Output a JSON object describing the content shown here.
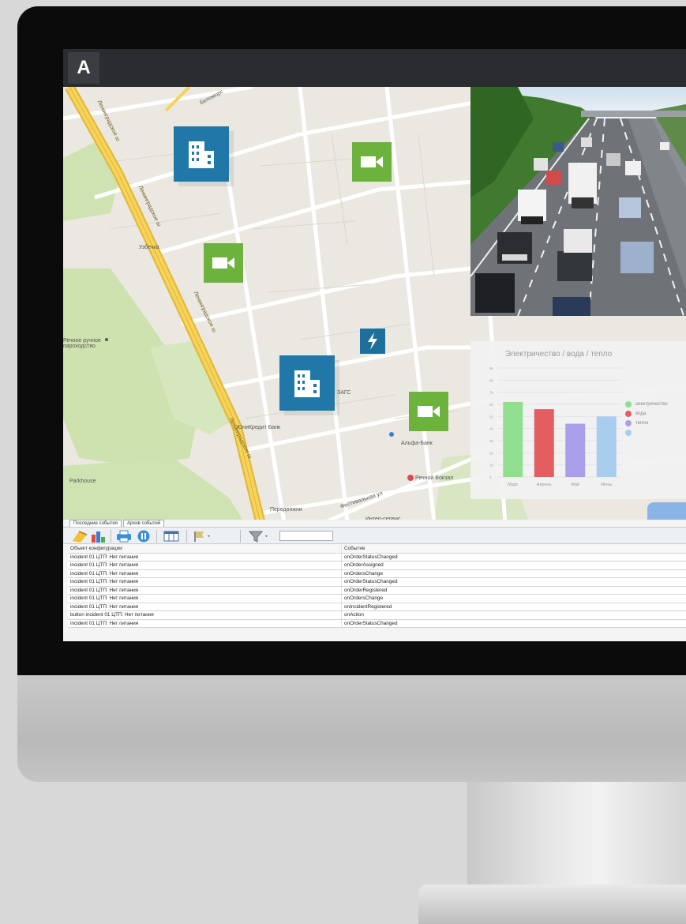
{
  "app": {
    "logo_letter": "A"
  },
  "map": {
    "labels": {
      "road1": "Ленинградское ш",
      "road2": "Ленинградское ш",
      "road3": "Ленинградское ш",
      "road4": "Ленинградское ш",
      "street_top": "Беломорс",
      "uzbekistan": "Узбечка",
      "rechnoe": "Речное ручное пароходство",
      "zags": "ЗАГС",
      "unicredit": "ЮниКредит Банк",
      "alfa": "Альфа-Банк",
      "rechnoy_vokzal": "Речной Вокзал",
      "parkhouse": "Parkhouse",
      "festivalnaya": "Фестивальная ул",
      "peredvizhnoy": "Передвижни",
      "intercom": "Интер-сервис"
    },
    "markers": [
      {
        "type": "building",
        "icon": "building-icon"
      },
      {
        "type": "building",
        "icon": "building-icon"
      },
      {
        "type": "camera",
        "icon": "video-camera-icon"
      },
      {
        "type": "camera",
        "icon": "video-camera-icon"
      },
      {
        "type": "camera",
        "icon": "video-camera-icon"
      },
      {
        "type": "power",
        "icon": "lightning-icon"
      }
    ],
    "colors": {
      "building": "#1f78a8",
      "camera": "#6eb23e",
      "power": "#1f6f9c",
      "highway": "#f5cf4e"
    }
  },
  "chart_data": {
    "type": "bar",
    "title": "Электричество / вода / тепло",
    "categories": [
      "Март",
      "Апрель",
      "Май",
      "Июнь"
    ],
    "values": [
      6.2,
      5.6,
      4.4,
      5.0
    ],
    "bar_colors": [
      "#8fdf8f",
      "#e35d61",
      "#a99ee8",
      "#a9cdef"
    ],
    "yticks": [
      "0",
      "1k",
      "2k",
      "3k",
      "4k",
      "5k",
      "6k",
      "7k",
      "8k",
      "9k"
    ],
    "ylim": [
      0,
      9
    ],
    "legend": [
      {
        "label": "электричество",
        "color": "#8fdf8f"
      },
      {
        "label": "вода",
        "color": "#e35d61"
      },
      {
        "label": "тепло",
        "color": "#a99ee8"
      },
      {
        "label": "",
        "color": "#a9cdef"
      }
    ],
    "legend_position": "right",
    "grid": true
  },
  "events": {
    "tabs": [
      "Последние события",
      "Архив событий"
    ],
    "columns": [
      "Объект конфигурации",
      "Событие"
    ],
    "rows": [
      [
        "incident 01 ЦТП: Нет питания",
        "onOrderStatusChanged"
      ],
      [
        "incident 01 ЦТП: Нет питания",
        "onOrderAssigned"
      ],
      [
        "incident 01 ЦТП: Нет питания",
        "onOrdersChange"
      ],
      [
        "incident 01 ЦТП: Нет питания",
        "onOrderStatusChanged"
      ],
      [
        "incident 01 ЦТП: Нет питания",
        "onOrderRegistered"
      ],
      [
        "incident 01 ЦТП: Нет питания",
        "onOrdersChange"
      ],
      [
        "incident 01 ЦТП: Нет питания",
        "onIncidentRegistered"
      ],
      [
        "button incident 01 ЦТП: Нет питания",
        "onAction"
      ],
      [
        "incident 01 ЦТП: Нет питания",
        "onOrderStatusChanged"
      ]
    ],
    "toolbar_icons": [
      "broom-icon",
      "bar-chart-icon",
      "printer-icon",
      "pause-icon",
      "columns-icon",
      "flag-icon",
      "filter-icon"
    ],
    "filter_value": ""
  }
}
